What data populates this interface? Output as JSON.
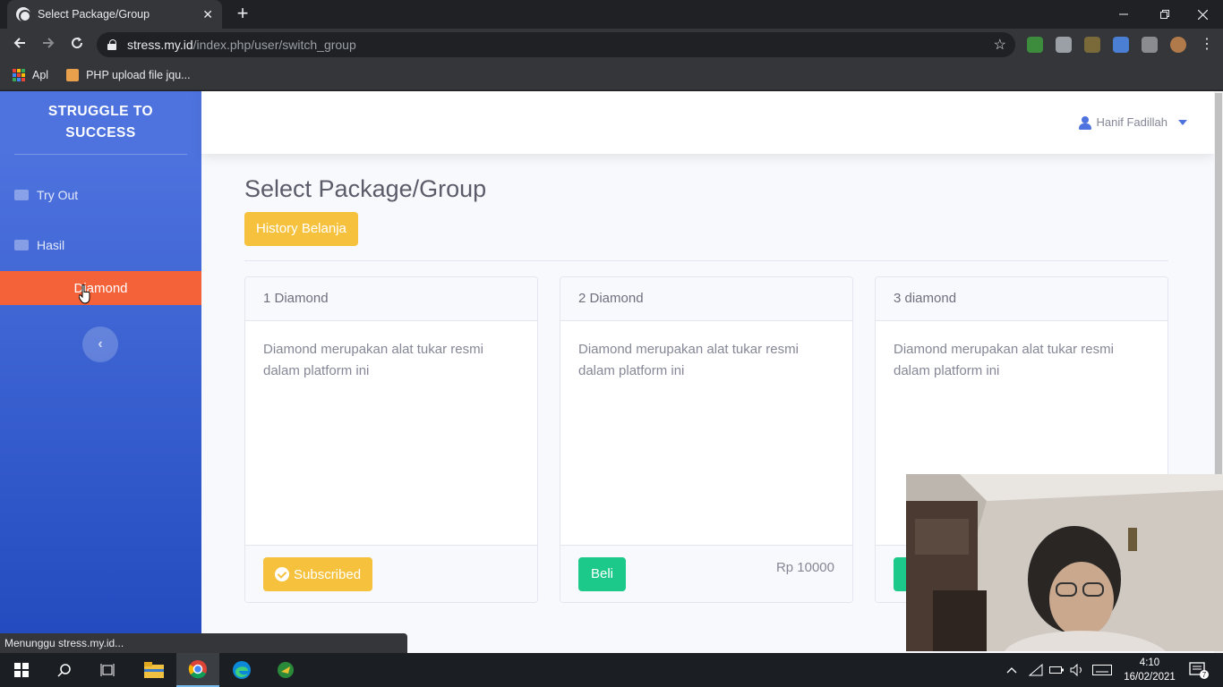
{
  "browser": {
    "tab_title": "Select Package/Group",
    "tab_close": "✕",
    "new_tab": "+",
    "url_host": "stress.my.id",
    "url_path": "/index.php/user/switch_group",
    "bookmarks": [
      {
        "label": "Apl",
        "icon": "apps-grid-icon"
      },
      {
        "label": "PHP upload file jqu...",
        "icon": "bookmark-favicon-icon"
      }
    ],
    "status_text": "Menunggu stress.my.id..."
  },
  "sidebar": {
    "brand": "STRUGGLE TO SUCCESS",
    "items": [
      {
        "label": "Try Out",
        "icon": "desktop-icon"
      },
      {
        "label": "Hasil",
        "icon": "folder-icon"
      },
      {
        "label": "Diamond",
        "active": true
      }
    ],
    "toggle": "‹"
  },
  "topbar": {
    "user_name": "Hanif Fadillah"
  },
  "main": {
    "title": "Select Package/Group",
    "history_button": "History Belanja",
    "cards": [
      {
        "title": "1 Diamond",
        "description": "Diamond merupakan alat tukar resmi dalam platform ini",
        "button": "Subscribed",
        "price": ""
      },
      {
        "title": "2 Diamond",
        "description": "Diamond merupakan alat tukar resmi dalam platform ini",
        "button": "Beli",
        "price": "Rp 10000"
      },
      {
        "title": "3 diamond",
        "description": "Diamond merupakan alat tukar resmi dalam platform ini",
        "button": "",
        "price": ""
      }
    ]
  },
  "taskbar": {
    "time": "4:10",
    "date": "16/02/2021",
    "notification_count": "7"
  },
  "colors": {
    "primary": "#4e73df",
    "active_nav": "#f4623a",
    "warning": "#f6c23e",
    "success": "#1cc88a"
  }
}
